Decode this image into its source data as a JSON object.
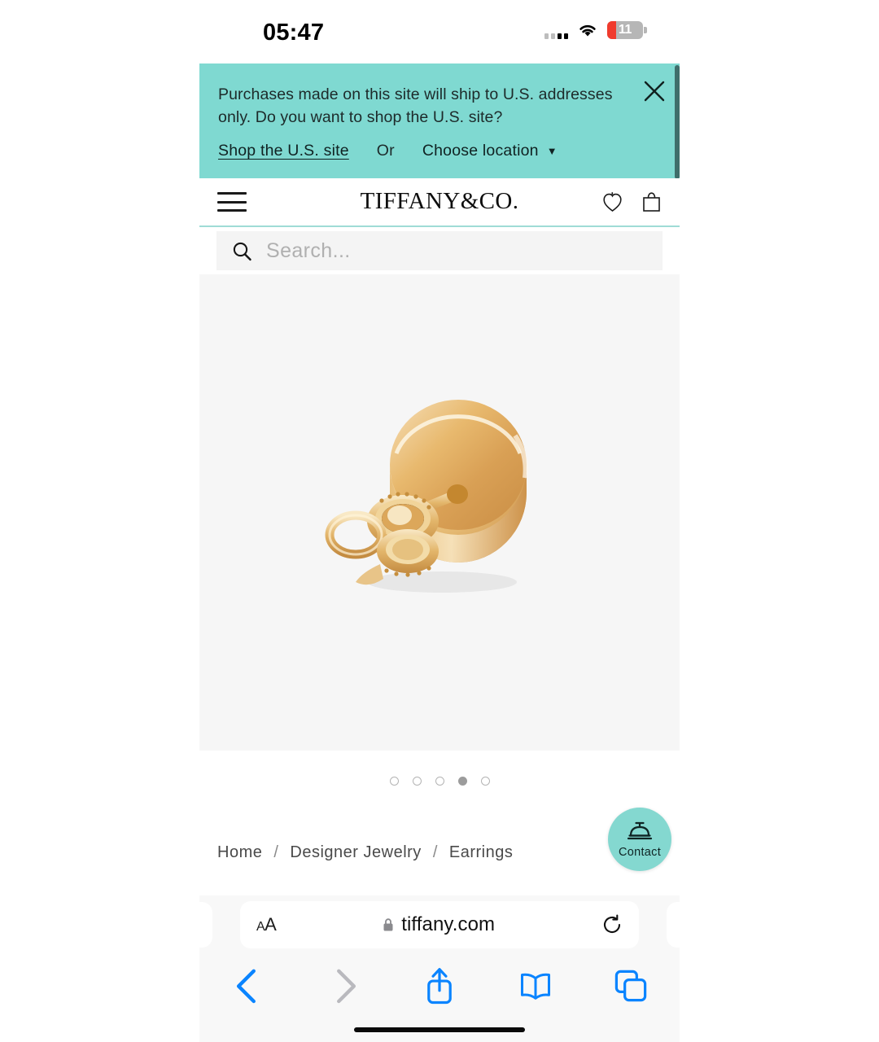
{
  "status_bar": {
    "time": "05:47",
    "signal_icon": "cellular-bars-icon",
    "wifi_icon": "wifi-icon",
    "battery_level": "11",
    "battery_low_color": "#f03b2d"
  },
  "theme": {
    "tiffany_blue": "#7fd9d1",
    "gallery_bg": "#f6f6f6",
    "search_bg": "#f4f4f4",
    "safari_accent": "#0a84ff"
  },
  "banner": {
    "message": "Purchases made on this site will ship to U.S. addresses only. Do you want to shop the U.S. site?",
    "shop_link": "Shop the U.S. site",
    "or_label": "Or",
    "choose_location": "Choose location",
    "caret_icon": "caret-down-icon",
    "close_icon": "close-icon"
  },
  "site_header": {
    "menu_icon": "hamburger-menu-icon",
    "logo": "TIFFANY&CO.",
    "wishlist_icon": "heart-icon",
    "cart_icon": "shopping-bag-icon"
  },
  "search": {
    "icon": "search-icon",
    "value": "",
    "placeholder": "Search..."
  },
  "gallery": {
    "product_image_alt": "gold-earring-stud-with-butterfly-back",
    "dots_total": 5,
    "dot_active_index": 4
  },
  "breadcrumb": {
    "items": [
      "Home",
      "Designer Jewelry",
      "Earrings"
    ],
    "separator": "/"
  },
  "contact_fab": {
    "label": "Contact",
    "icon": "service-bell-icon"
  },
  "safari": {
    "text_size_button": "AA",
    "lock_icon": "lock-icon",
    "url": "tiffany.com",
    "reload_icon": "reload-icon",
    "back_icon": "chevron-left-icon",
    "forward_icon": "chevron-right-icon",
    "share_icon": "share-icon",
    "bookmarks_icon": "book-icon",
    "tabs_icon": "tabs-icon"
  }
}
